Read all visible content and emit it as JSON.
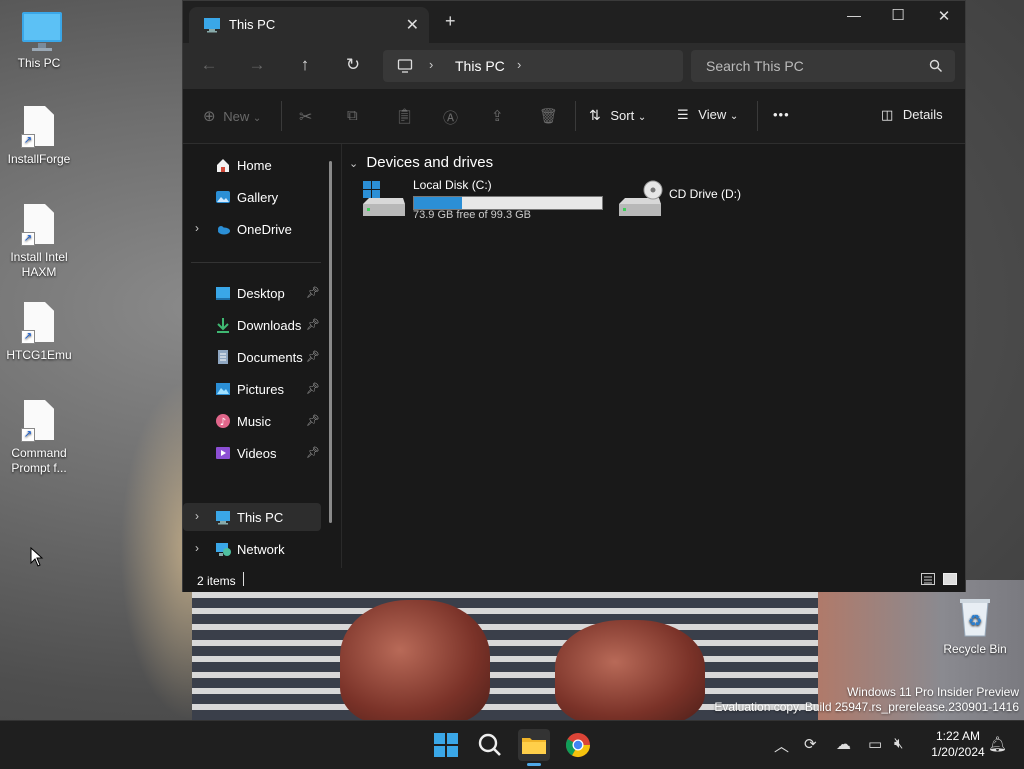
{
  "desktop": {
    "icons": [
      {
        "label": "This PC"
      },
      {
        "label": "InstallForge"
      },
      {
        "label": "Install Intel HAXM"
      },
      {
        "label": "HTCG1Emu"
      },
      {
        "label": "Command Prompt f..."
      },
      {
        "label": "Recycle Bin"
      }
    ],
    "watermark": {
      "line1": "Windows 11 Pro Insider Preview",
      "line2": "Evaluation copy. Build 25947.rs_prerelease.230901-1416"
    }
  },
  "window": {
    "tab_title": "This PC",
    "controls": {
      "minimize": "—",
      "maximize": "☐",
      "close": "✕"
    },
    "new_tab": "+",
    "address": {
      "crumb": "This PC"
    },
    "search": {
      "placeholder": "Search This PC"
    },
    "toolbar": {
      "new_label": "New",
      "sort_label": "Sort",
      "view_label": "View",
      "more_label": "•••",
      "details_label": "Details"
    },
    "sidebar": {
      "quick": [
        {
          "label": "Home",
          "icon": "home-icon"
        },
        {
          "label": "Gallery",
          "icon": "gallery-icon"
        },
        {
          "label": "OneDrive",
          "icon": "cloud-icon"
        }
      ],
      "pinned": [
        {
          "label": "Desktop",
          "icon": "desktop-icon"
        },
        {
          "label": "Downloads",
          "icon": "download-icon"
        },
        {
          "label": "Documents",
          "icon": "document-icon"
        },
        {
          "label": "Pictures",
          "icon": "pictures-icon"
        },
        {
          "label": "Music",
          "icon": "music-icon"
        },
        {
          "label": "Videos",
          "icon": "videos-icon"
        }
      ],
      "places": [
        {
          "label": "This PC",
          "icon": "computer-icon"
        },
        {
          "label": "Network",
          "icon": "network-icon"
        }
      ]
    },
    "content": {
      "group_title": "Devices and drives",
      "drives": [
        {
          "name": "Local Disk (C:)",
          "free": "73.9 GB free of 99.3 GB",
          "used_fraction": 0.256
        },
        {
          "name": "CD Drive (D:)"
        }
      ]
    },
    "status": {
      "item_count": "2 items"
    }
  },
  "taskbar": {
    "clock": {
      "time": "1:22 AM",
      "date": "1/20/2024"
    }
  },
  "colors": {
    "accent": "#2b8fd6",
    "window_bg": "#191919",
    "taskbar_bg": "#1f1f1f"
  }
}
